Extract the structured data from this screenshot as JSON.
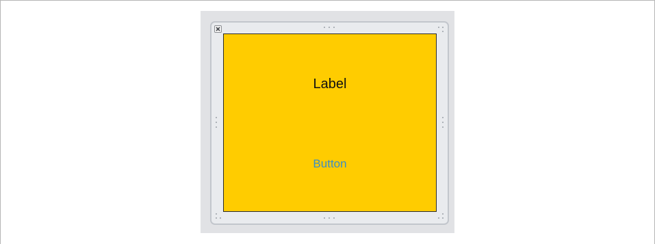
{
  "scene": {
    "label_text": "Label",
    "button_title": "Button"
  },
  "icons": {
    "close": "close-icon",
    "resize_handle": "resize-handle-icon"
  },
  "colors": {
    "view_background": "#ffcc00",
    "label_color": "#111111",
    "button_tint": "#3c8ec3",
    "canvas_background": "#e1e2e5"
  }
}
